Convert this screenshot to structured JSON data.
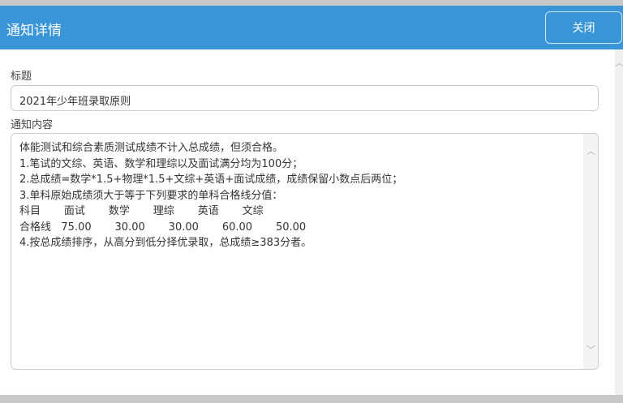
{
  "header": {
    "title": "通知详情",
    "close_label": "关闭"
  },
  "form": {
    "title_label": "标题",
    "title_value": "2021年少年班录取原则",
    "content_label": "通知内容",
    "content_lines": [
      "体能测试和综合素质测试成绩不计入总成绩，但须合格。",
      "1.笔试的文综、英语、数学和理综以及面试满分均为100分；",
      "2.总成绩=数学*1.5+物理*1.5+文综+英语+面试成绩，成绩保留小数点后两位；",
      "3.单科原始成绩须大于等于下列要求的单科合格线分值：",
      "科目       面试       数学       理综       英语       文综",
      "合格线   75.00       30.00       30.00       60.00       50.00",
      "4.按总成绩排序，从高分到低分择优录取，总成绩≥383分者。"
    ]
  }
}
